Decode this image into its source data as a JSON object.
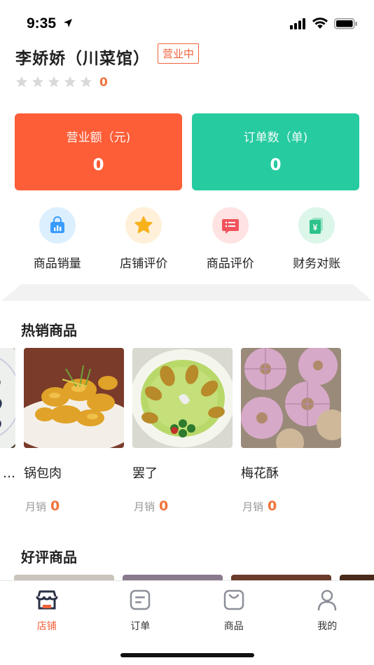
{
  "status_bar": {
    "time": "9:35"
  },
  "shop": {
    "name": "李娇娇（川菜馆）",
    "status": "营业中",
    "rating": "0",
    "stars": 5
  },
  "stats": {
    "revenue": {
      "label": "营业额（元)",
      "value": "0",
      "color": "#fd5d37"
    },
    "orders": {
      "label": "订单数（单)",
      "value": "0",
      "color": "#26cba0"
    }
  },
  "quick_actions": [
    {
      "label": "商品销量",
      "icon": "shopping-bag-chart-icon",
      "bg": "#dcefff",
      "fg": "#3a9bff"
    },
    {
      "label": "店铺评价",
      "icon": "star-badge-icon",
      "bg": "#fff0d9",
      "fg": "#f7b21c"
    },
    {
      "label": "商品评价",
      "icon": "message-list-icon",
      "bg": "#ffe3e3",
      "fg": "#f2535d"
    },
    {
      "label": "财务对账",
      "icon": "yen-document-icon",
      "bg": "#dcf6ea",
      "fg": "#2dc38b"
    }
  ],
  "hot_section": {
    "title": "热销商品",
    "sales_label": "月销",
    "products": [
      {
        "name": "…",
        "sales": ""
      },
      {
        "name": "锅包肉",
        "sales": "0"
      },
      {
        "name": "罢了",
        "sales": "0"
      },
      {
        "name": "梅花酥",
        "sales": "0"
      }
    ]
  },
  "good_section": {
    "title": "好评商品"
  },
  "tab_bar": {
    "tabs": [
      {
        "label": "店铺",
        "icon": "store-icon",
        "active": true
      },
      {
        "label": "订单",
        "icon": "order-icon",
        "active": false
      },
      {
        "label": "商品",
        "icon": "goods-bag-icon",
        "active": false
      },
      {
        "label": "我的",
        "icon": "profile-icon",
        "active": false
      }
    ]
  }
}
